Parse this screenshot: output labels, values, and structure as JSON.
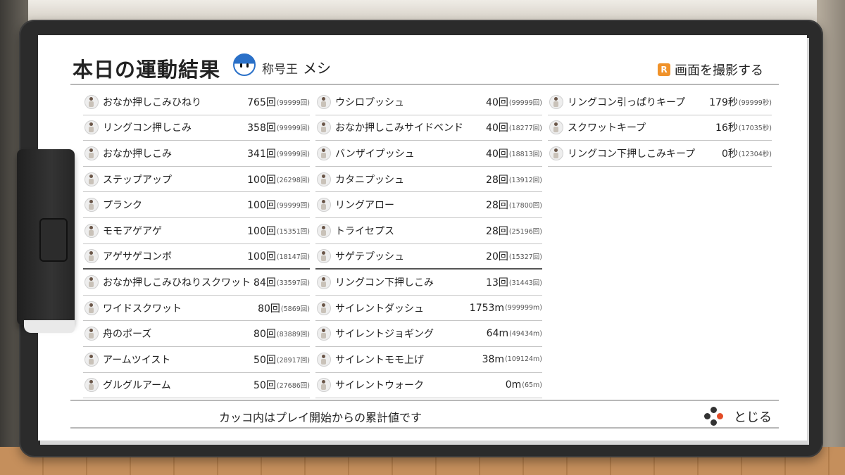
{
  "header": {
    "title": "本日の運動結果",
    "rank_label": "称号王",
    "rank_value": "メシ",
    "screenshot_button": "R",
    "screenshot_label": "画面を撮影する"
  },
  "columns": [
    [
      {
        "name": "おなか押しこみひねり",
        "value": "765回",
        "total": "(99999回)"
      },
      {
        "name": "リングコン押しこみ",
        "value": "358回",
        "total": "(99999回)"
      },
      {
        "name": "おなか押しこみ",
        "value": "341回",
        "total": "(99999回)"
      },
      {
        "name": "ステップアップ",
        "value": "100回",
        "total": "(26298回)"
      },
      {
        "name": "プランク",
        "value": "100回",
        "total": "(99999回)"
      },
      {
        "name": "モモアゲアゲ",
        "value": "100回",
        "total": "(15351回)"
      },
      {
        "name": "アゲサゲコンボ",
        "value": "100回",
        "total": "(18147回)"
      },
      {
        "name": "おなか押しこみひねりスクワット",
        "value": "84回",
        "total": "(33597回)"
      },
      {
        "name": "ワイドスクワット",
        "value": "80回",
        "total": "(5869回)"
      },
      {
        "name": "舟のポーズ",
        "value": "80回",
        "total": "(83889回)"
      },
      {
        "name": "アームツイスト",
        "value": "50回",
        "total": "(28917回)"
      },
      {
        "name": "グルグルアーム",
        "value": "50回",
        "total": "(27686回)"
      }
    ],
    [
      {
        "name": "ウシロプッシュ",
        "value": "40回",
        "total": "(99999回)"
      },
      {
        "name": "おなか押しこみサイドベンド",
        "value": "40回",
        "total": "(18277回)"
      },
      {
        "name": "バンザイプッシュ",
        "value": "40回",
        "total": "(18813回)"
      },
      {
        "name": "カタニプッシュ",
        "value": "28回",
        "total": "(13912回)"
      },
      {
        "name": "リングアロー",
        "value": "28回",
        "total": "(17800回)"
      },
      {
        "name": "トライセプス",
        "value": "28回",
        "total": "(25196回)"
      },
      {
        "name": "サゲテプッシュ",
        "value": "20回",
        "total": "(15327回)"
      },
      {
        "name": "リングコン下押しこみ",
        "value": "13回",
        "total": "(31443回)"
      },
      {
        "name": "サイレントダッシュ",
        "value": "1753m",
        "total": "(999999m)"
      },
      {
        "name": "サイレントジョギング",
        "value": "64m",
        "total": "(49434m)"
      },
      {
        "name": "サイレントモモ上げ",
        "value": "38m",
        "total": "(109124m)"
      },
      {
        "name": "サイレントウォーク",
        "value": "0m",
        "total": "(65m)"
      }
    ],
    [
      {
        "name": "リングコン引っぱりキープ",
        "value": "179秒",
        "total": "(99999秒)"
      },
      {
        "name": "スクワットキープ",
        "value": "16秒",
        "total": "(17035秒)"
      },
      {
        "name": "リングコン下押しこみキープ",
        "value": "0秒",
        "total": "(12304秒)"
      }
    ]
  ],
  "footer": {
    "note": "カッコ内はプレイ開始からの累計値です",
    "close_label": "とじる"
  }
}
